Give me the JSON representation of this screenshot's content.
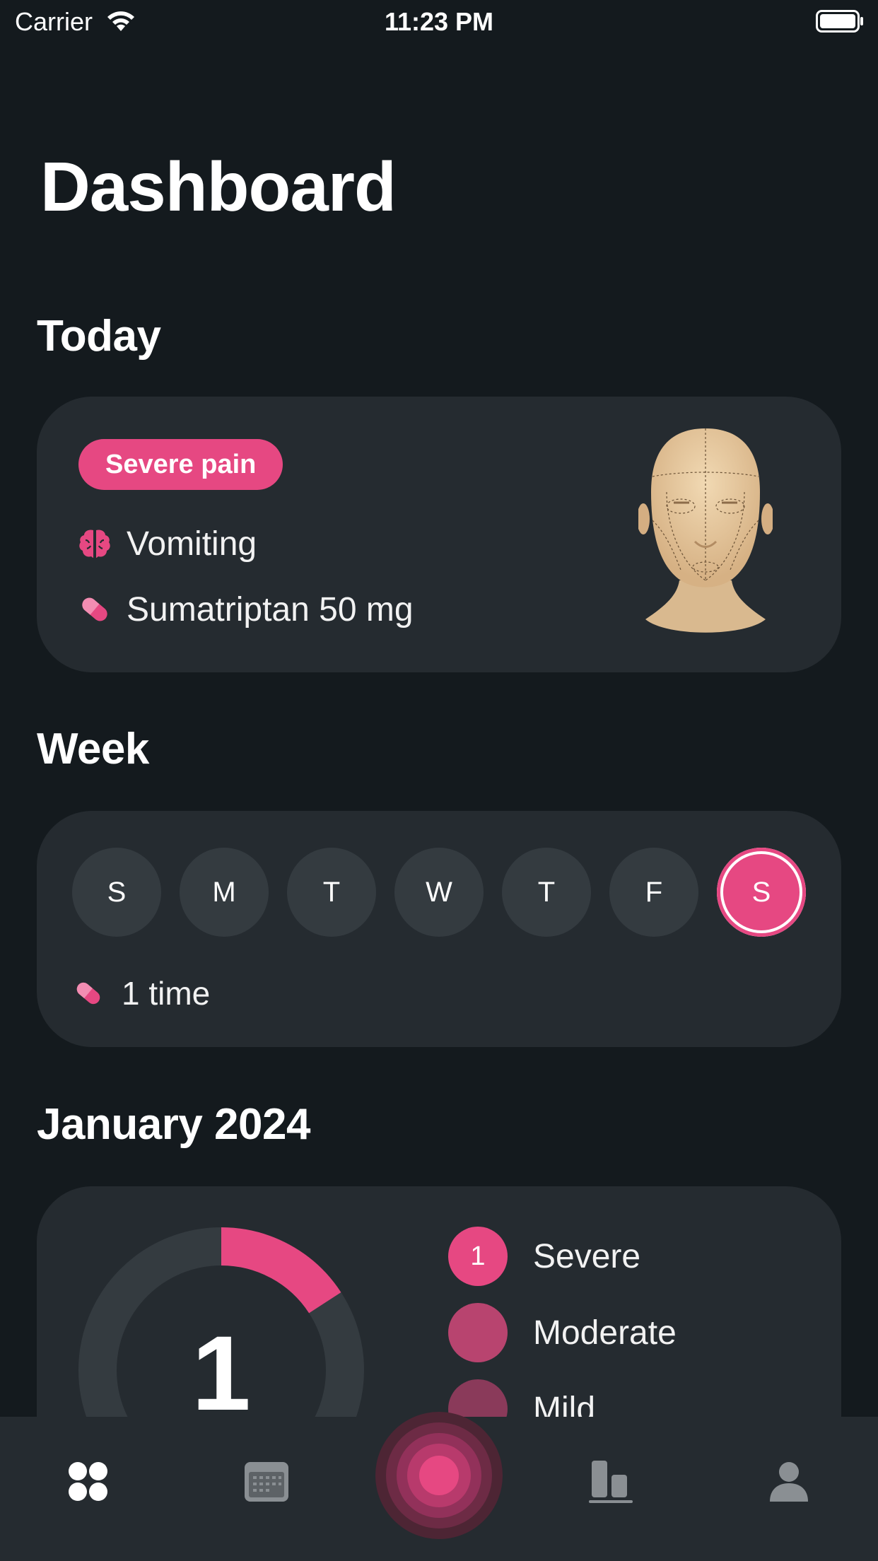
{
  "status_bar": {
    "carrier": "Carrier",
    "time": "11:23 PM"
  },
  "page": {
    "title": "Dashboard"
  },
  "today": {
    "heading": "Today",
    "pain_badge": "Severe pain",
    "symptom": "Vomiting",
    "medication": "Sumatriptan 50 mg",
    "colors": {
      "accent": "#e64882",
      "card": "#252b30"
    }
  },
  "week": {
    "heading": "Week",
    "days": [
      "S",
      "M",
      "T",
      "W",
      "T",
      "F",
      "S"
    ],
    "active_day_index": 6,
    "medication_count": "1 time"
  },
  "month": {
    "heading": "January 2024",
    "total": "1",
    "legend": [
      {
        "label": "Severe",
        "count": "1",
        "color": "#e64882"
      },
      {
        "label": "Moderate",
        "count": "",
        "color": "#b8446f"
      },
      {
        "label": "Mild",
        "count": "",
        "color": "#8a3a5a"
      }
    ]
  },
  "tab_bar": {
    "tabs": [
      {
        "icon": "grid-dots-icon"
      },
      {
        "icon": "calendar-icon"
      },
      {
        "icon": "record-attack-icon"
      },
      {
        "icon": "bar-chart-icon"
      },
      {
        "icon": "person-icon"
      }
    ]
  }
}
